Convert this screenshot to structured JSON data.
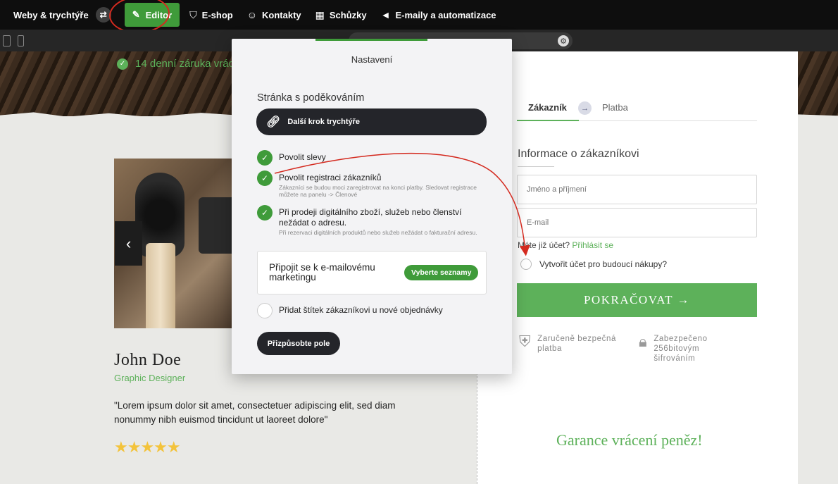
{
  "topnav": {
    "brand": "Weby & trychtýře",
    "items": [
      {
        "label": "Editor",
        "icon": "edit-icon"
      },
      {
        "label": "E-shop",
        "icon": "bag-icon"
      },
      {
        "label": "Kontakty",
        "icon": "contacts-icon"
      },
      {
        "label": "Schůzky",
        "icon": "calendar-icon"
      },
      {
        "label": "E-maily a automatizace",
        "icon": "megaphone-icon"
      }
    ]
  },
  "hero": {
    "guarantee": "14 denní záruka vrác"
  },
  "testimonial": {
    "name": "John Doe",
    "role": "Graphic Designer",
    "quote": "\"Lorem ipsum dolor sit amet, consectetuer adipiscing elit, sed diam nonummy nibh euismod tincidunt ut laoreet dolore\"",
    "rating": 5,
    "stars": "★★★★★"
  },
  "checkout": {
    "tab_active": "Zákazník",
    "tab_next": "Platba",
    "info_title": "Informace o zákazníkovi",
    "name_placeholder": "Jméno a příjmení",
    "email_placeholder": "E-mail",
    "has_account": "Máte již účet?",
    "login_link": "Přihlásit se",
    "create_account": "Vytvořit účet pro budoucí nákupy?",
    "continue_label": "POKRAČOVAT →",
    "trust_secure": "Zaručeně bezpečná platba",
    "trust_encrypted": "Zabezpečeno 256bitovým šifrováním",
    "money_back": "Garance vrácení peněz!"
  },
  "settings": {
    "title": "Nastavení",
    "section_title": "Stránka s poděkováním",
    "next_step_label": "Další krok trychtýře",
    "options": [
      {
        "label": "Povolit slevy",
        "desc": "",
        "checked": true
      },
      {
        "label": "Povolit registraci zákazníků",
        "desc": "Zákazníci se budou moci zaregistrovat na konci platby. Sledovat registrace můžete na panelu -> Členové",
        "checked": true
      },
      {
        "label": "Při prodeji digitálního zboží, služeb nebo členství nežádat o adresu.",
        "desc": "Při rezervaci digitálních produktů nebo služeb nežádat o fakturační adresu.",
        "checked": true
      }
    ],
    "mail_label": "Připojit se k e-mailovému marketingu",
    "mail_button": "Vyberte seznamy",
    "tag_label": "Přidat štítek zákazníkovi u nové objednávky",
    "tag_checked": false,
    "customize_label": "Přizpůsobte pole"
  },
  "colors": {
    "brand_green": "#5db15a",
    "editor_green": "#3f9b3a",
    "annotation_red": "#d42a1f"
  }
}
